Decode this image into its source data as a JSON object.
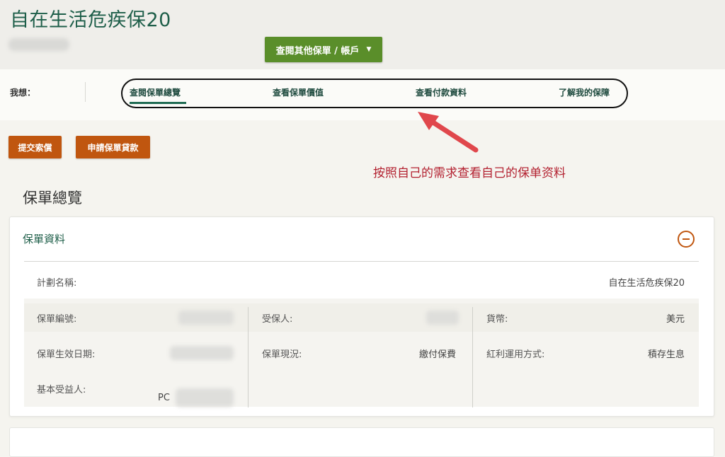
{
  "header": {
    "title": "自在生活危疾保20",
    "policy_dropdown_label": "查閱其他保單 / 帳戶"
  },
  "nav": {
    "want_label": "我想：",
    "tabs": [
      {
        "label": "查閱保單總覽",
        "active": true
      },
      {
        "label": "查看保單價值"
      },
      {
        "label": "查看付款資料"
      },
      {
        "label": "了解我的保障"
      }
    ]
  },
  "actions": {
    "submit_claim": "提交索償",
    "apply_loan": "申請保單貸款"
  },
  "annotation": {
    "text": "按照自己的需求查看自己的保单资料",
    "color": "#b32130"
  },
  "overview": {
    "title": "保單總覽",
    "card_title": "保單資料",
    "plan_name_label": "計劃名稱:",
    "plan_name_value": "自在生活危疾保20",
    "policy_no_label": "保單編號:",
    "insured_label": "受保人:",
    "currency_label": "貨幣:",
    "currency_value": "美元",
    "effective_date_label": "保單生效日期:",
    "status_label": "保單現況:",
    "status_value": "繳付保費",
    "dividend_label": "紅利運用方式:",
    "dividend_value": "積存生息",
    "beneficiary_label": "基本受益人:",
    "beneficiary_partial": "PC"
  },
  "colors": {
    "brand_green": "#1f5f4a",
    "dropdown_green": "#5a8e2a",
    "action_orange": "#c0560f"
  }
}
